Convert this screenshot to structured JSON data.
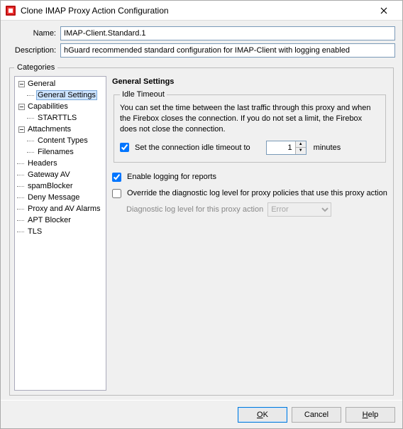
{
  "window": {
    "title": "Clone IMAP Proxy Action Configuration"
  },
  "form": {
    "name_label": "Name:",
    "name_value": "IMAP-Client.Standard.1",
    "desc_label": "Description:",
    "desc_value": "hGuard recommended standard configuration for IMAP-Client with logging enabled"
  },
  "categories_legend": "Categories",
  "tree": {
    "general": "General",
    "general_settings": "General Settings",
    "capabilities": "Capabilities",
    "starttls": "STARTTLS",
    "attachments": "Attachments",
    "content_types": "Content Types",
    "filenames": "Filenames",
    "headers": "Headers",
    "gateway_av": "Gateway AV",
    "spamblocker": "spamBlocker",
    "deny_message": "Deny Message",
    "proxy_av_alarms": "Proxy and AV Alarms",
    "apt_blocker": "APT Blocker",
    "tls": "TLS"
  },
  "right": {
    "heading": "General Settings",
    "idle_legend": "Idle Timeout",
    "idle_hint": "You can set the time between the last traffic through this proxy and when the Firebox closes the connection. If you do not set a limit, the Firebox does not close the connection.",
    "idle_chk_label": "Set the connection idle timeout to",
    "idle_value": "1",
    "idle_unit": "minutes",
    "enable_logging_label": "Enable logging for reports",
    "override_diag_label": "Override the diagnostic log level for proxy policies that use this proxy action",
    "diag_label": "Diagnostic log level for this proxy action",
    "diag_value": "Error"
  },
  "buttons": {
    "ok": "OK",
    "cancel": "Cancel",
    "help": "Help"
  }
}
